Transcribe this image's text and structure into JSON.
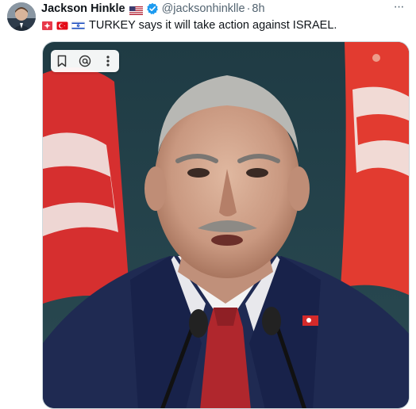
{
  "tweet": {
    "author": {
      "display_name": "Jackson Hinkle",
      "handle": "@jacksonhinklle",
      "verified": true,
      "flag_icon": "us-flag-icon"
    },
    "separator": "·",
    "time": "8h",
    "emojis": [
      "flag-icon",
      "turkey-flag-icon",
      "israel-flag-icon"
    ],
    "text": "TURKEY says it will take action against ISRAEL.",
    "more_icon": "more-options-icon"
  },
  "media": {
    "toolbar": [
      "bookmark-icon",
      "at-mention-icon",
      "more-vertical-icon"
    ]
  },
  "colors": {
    "primary_text": "#0f1419",
    "secondary_text": "#536471",
    "verified_blue": "#1d9bf0",
    "border": "#cfd9de"
  }
}
